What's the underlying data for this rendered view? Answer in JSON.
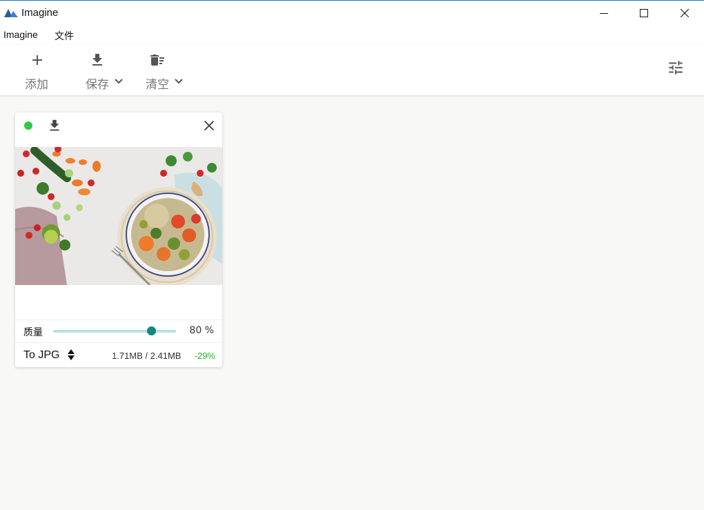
{
  "window": {
    "title": "Imagine",
    "controls": [
      "minimize-icon",
      "maximize-icon",
      "close-icon"
    ]
  },
  "menu": {
    "items": [
      "Imagine",
      "文件"
    ]
  },
  "toolbar": {
    "add_label": "添加",
    "save_label": "保存",
    "clear_label": "清空",
    "icons": [
      "plus-icon",
      "download-icon",
      "delete-sweep-icon",
      "chevron-down-icon",
      "tune-icon"
    ]
  },
  "card": {
    "status_color": "#34c548",
    "thumbnail": "food bowl with vegetables",
    "quality_label": "质量",
    "quality_percent": 80,
    "quality_value": "80 %",
    "format_label": "To JPG",
    "size_text": "1.71MB / 2.41MB",
    "size_delta": "-29%",
    "delta_color": "#21b421",
    "accent_color": "#118a7e"
  }
}
